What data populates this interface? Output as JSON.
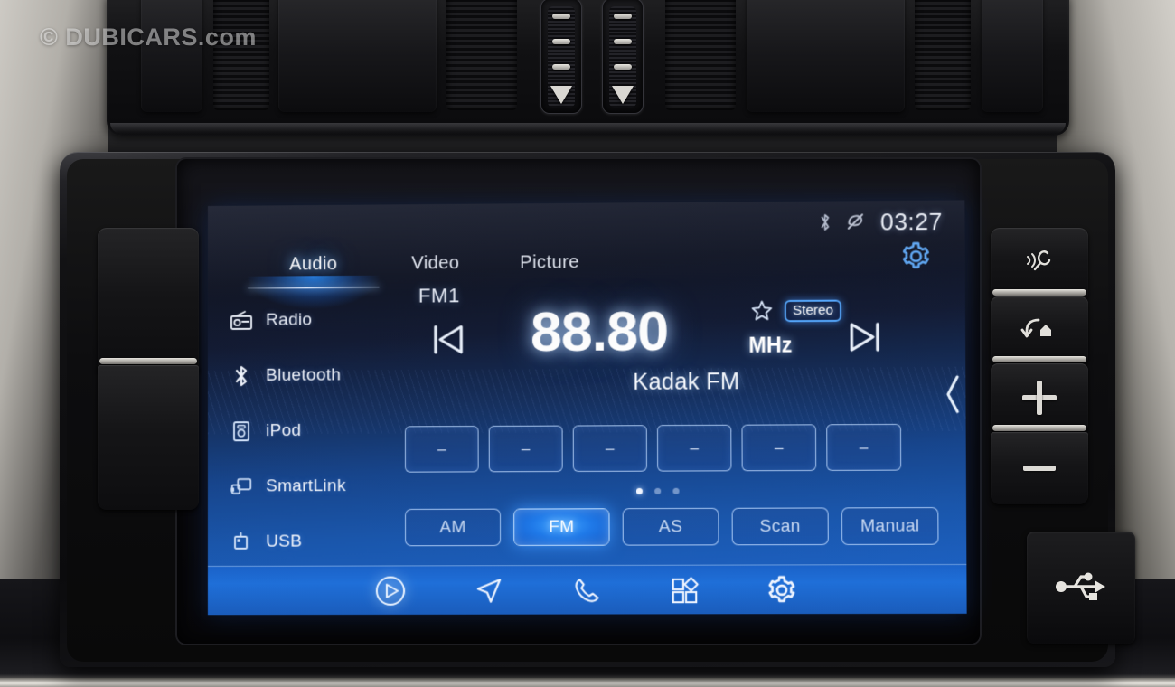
{
  "watermark": "© DUBICARS.com",
  "screen": {
    "statusbar": {
      "bluetooth_icon": "bluetooth-icon",
      "gps_off_icon": "gps-disabled-icon",
      "time": "03:27"
    },
    "tabs": [
      {
        "label": "Audio",
        "active": true
      },
      {
        "label": "Video",
        "active": false
      },
      {
        "label": "Picture",
        "active": false
      }
    ],
    "settings_gear": "gear-icon",
    "sidebar": {
      "items": [
        {
          "label": "Radio",
          "icon": "radio-icon",
          "active": true
        },
        {
          "label": "Bluetooth",
          "icon": "bluetooth-icon",
          "active": false
        },
        {
          "label": "iPod",
          "icon": "ipod-icon",
          "active": false
        },
        {
          "label": "SmartLink",
          "icon": "smartlink-icon",
          "active": false
        },
        {
          "label": "USB",
          "icon": "usb-icon",
          "active": false
        }
      ]
    },
    "tuner": {
      "band": "FM1",
      "frequency": "88.80",
      "unit": "MHz",
      "stereo_badge": "Stereo",
      "favorite_icon": "star-outline-icon",
      "station_name": "Kadak FM",
      "prev_icon": "skip-previous-icon",
      "next_icon": "skip-next-icon",
      "collapse_icon": "chevron-left-icon"
    },
    "presets": {
      "empty_label": "–",
      "items": [
        "–",
        "–",
        "–",
        "–",
        "–",
        "–"
      ],
      "page_dots": 3,
      "active_page": 0
    },
    "modes": [
      {
        "label": "AM",
        "active": false
      },
      {
        "label": "FM",
        "active": true
      },
      {
        "label": "AS",
        "active": false
      },
      {
        "label": "Scan",
        "active": false
      },
      {
        "label": "Manual",
        "active": false
      }
    ],
    "navbar": [
      {
        "icon": "media-play-icon",
        "selected": true
      },
      {
        "icon": "navigation-icon",
        "selected": false
      },
      {
        "icon": "phone-icon",
        "selected": false
      },
      {
        "icon": "apps-grid-icon",
        "selected": false
      },
      {
        "icon": "settings-gear-icon",
        "selected": false
      }
    ]
  },
  "hardware": {
    "left_buttons": [
      {
        "name": "left-blank-button-top"
      },
      {
        "name": "left-blank-button-bottom"
      }
    ],
    "right_buttons": [
      {
        "icon": "voice-command-icon",
        "label": ""
      },
      {
        "icon": "back-home-icon",
        "label": ""
      },
      {
        "icon": "volume-up-icon",
        "label": ""
      },
      {
        "icon": "volume-down-icon",
        "label": ""
      }
    ],
    "usb_port_icon": "usb-icon"
  },
  "colors": {
    "accent_blue": "#2f86f0",
    "active_tab_glow": "#2a8cff",
    "screen_top": "#10131f",
    "screen_bottom": "#1c5fbe",
    "navbar_blue": "#1f6fd8",
    "text_primary": "#ffffff"
  }
}
